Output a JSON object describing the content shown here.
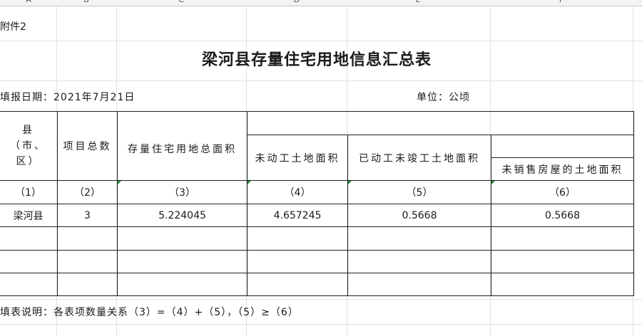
{
  "columns": [
    "A",
    "B",
    "C",
    "D",
    "E",
    "F"
  ],
  "attachment_label": "附件2",
  "title": "梁河县存量住宅用地信息汇总表",
  "fill_date": "填报日期：2021年7月21日",
  "unit": "单位：公顷",
  "headers": {
    "county": "县（市、区）",
    "project_count": "项目总数",
    "total_area": "存量住宅用地总面积",
    "unstarted_area": "未动工土地面积",
    "started_unfinished_area": "已动工未竣工土地面积",
    "unsold_area": "未销售房屋的土地面积"
  },
  "index_row": [
    "（1）",
    "（2）",
    "（3）",
    "（4）",
    "（5）",
    "（6）"
  ],
  "rows": [
    [
      "梁河县",
      "3",
      "5.224045",
      "4.657245",
      "0.5668",
      "0.5668"
    ],
    [
      "",
      "",
      "",
      "",
      "",
      ""
    ],
    [
      "",
      "",
      "",
      "",
      "",
      ""
    ],
    [
      "",
      "",
      "",
      "",
      "",
      ""
    ]
  ],
  "note": "填表说明：各表项数量关系（3）=（4）+（5），（5）≥（6）"
}
